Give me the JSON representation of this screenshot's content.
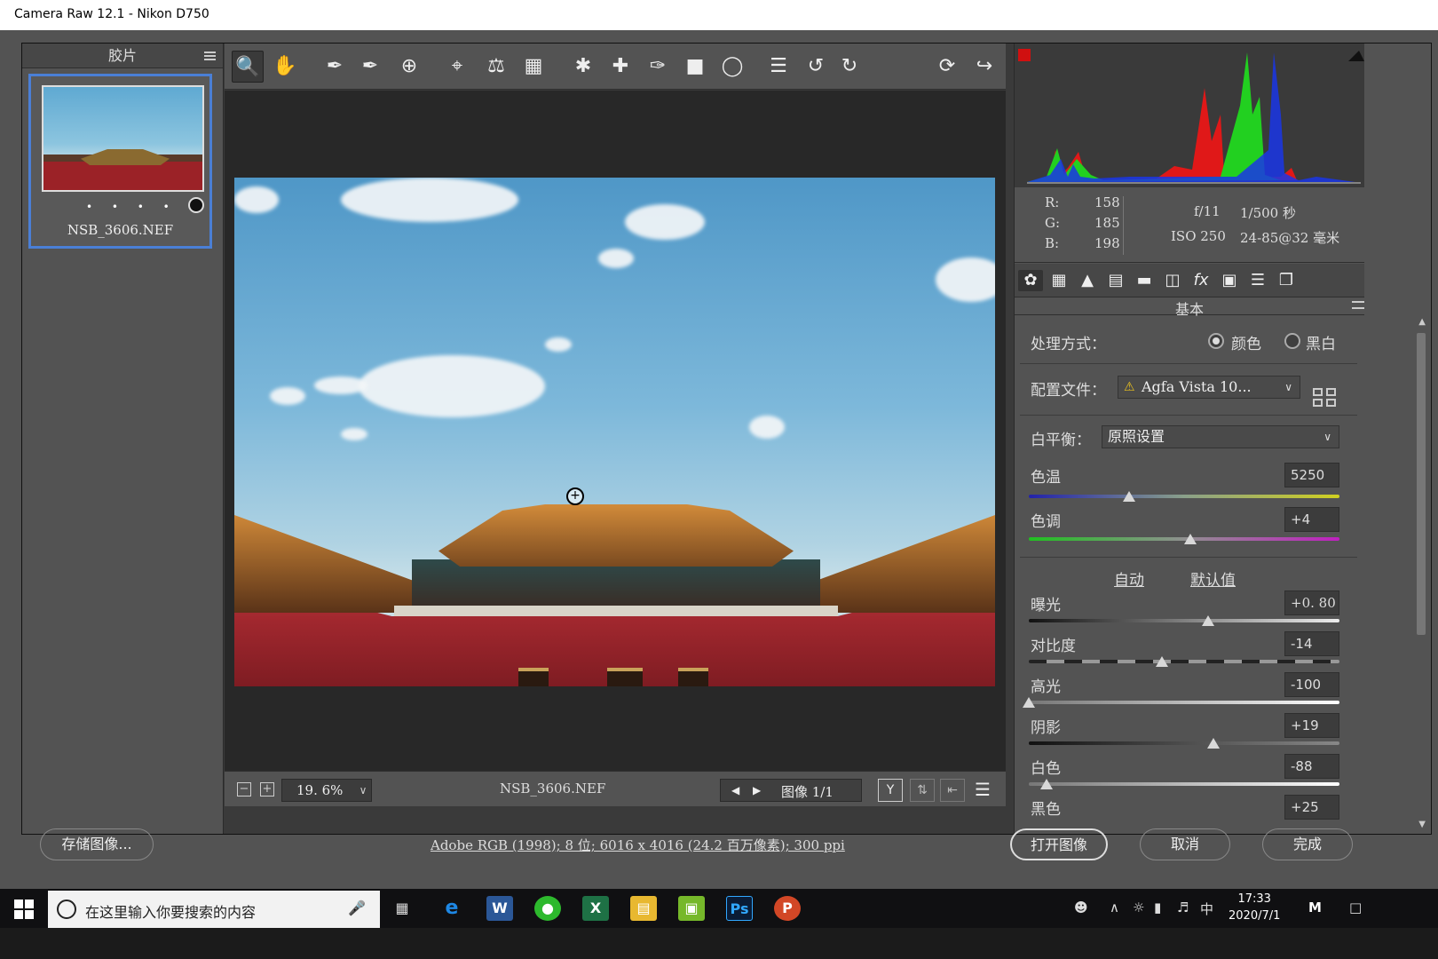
{
  "window": {
    "title": "Camera Raw 12.1 -  Nikon D750"
  },
  "filmstrip": {
    "title": "胶片",
    "thumb_filename": "NSB_3606.NEF",
    "thumb_dots": "• • • • •"
  },
  "toolbar": {
    "tools": [
      "zoom-tool",
      "hand-tool",
      "white-balance-tool",
      "color-sampler-tool",
      "targeted-adjustment-tool",
      "crop-tool",
      "straighten-tool",
      "transform-tool",
      "spot-removal-tool",
      "red-eye-tool",
      "adjustment-brush",
      "graduated-filter",
      "radial-filter",
      "preferences",
      "rotate-left",
      "rotate-right"
    ],
    "selected": "zoom-tool"
  },
  "preview": {
    "zoom": "19. 6%",
    "filename": "NSB_3606.NEF",
    "image_label": "图像 1/1"
  },
  "readout": {
    "r_label": "R:",
    "r": "158",
    "g_label": "G:",
    "g": "185",
    "b_label": "B:",
    "b": "198",
    "aperture": "f/11",
    "shutter": "1/500 秒",
    "iso": "ISO 250",
    "lens": "24-85@32 毫米"
  },
  "panel": {
    "title": "基本",
    "treatment_label": "处理方式：",
    "treatment_options": [
      "颜色",
      "黑白"
    ],
    "treatment_selected": "颜色",
    "profile_label": "配置文件：",
    "profile_value": "Agfa Vista 10...",
    "wb_label": "白平衡：",
    "wb_value": "原照设置",
    "auto_label": "自动",
    "default_label": "默认值",
    "sliders": [
      {
        "label": "色温",
        "value": "5250"
      },
      {
        "label": "色调",
        "value": "+4"
      },
      {
        "label": "曝光",
        "value": "+0. 80"
      },
      {
        "label": "对比度",
        "value": "-14"
      },
      {
        "label": "高光",
        "value": "-100"
      },
      {
        "label": "阴影",
        "value": "+19"
      },
      {
        "label": "白色",
        "value": "-88"
      },
      {
        "label": "黑色",
        "value": "+25"
      }
    ]
  },
  "footer": {
    "save_label": "存储图像...",
    "info": "Adobe RGB (1998); 8 位; 6016 x 4016 (24.2 百万像素); 300 ppi",
    "open_label": "打开图像",
    "cancel_label": "取消",
    "done_label": "完成"
  },
  "taskbar": {
    "search_placeholder": "在这里输入你要搜索的内容",
    "time": "17:33",
    "date": "2020/7/1",
    "ime": "中"
  },
  "colors": {
    "accent": "#4a7fd6",
    "panel_bg": "#535353",
    "preview_bg": "#282828"
  }
}
